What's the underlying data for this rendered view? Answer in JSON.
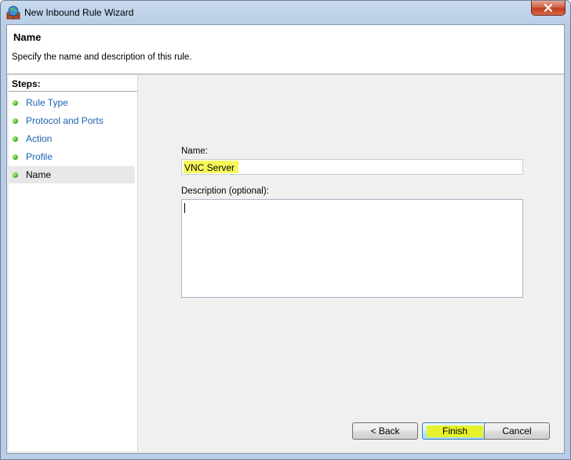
{
  "window": {
    "title": "New Inbound Rule Wizard"
  },
  "header": {
    "title": "Name",
    "description": "Specify the name and description of this rule."
  },
  "steps": {
    "title": "Steps:",
    "items": [
      {
        "label": "Rule Type"
      },
      {
        "label": "Protocol and Ports"
      },
      {
        "label": "Action"
      },
      {
        "label": "Profile"
      },
      {
        "label": "Name"
      }
    ]
  },
  "form": {
    "name_label": "Name:",
    "name_value": "VNC Server",
    "description_label": "Description (optional):",
    "description_value": ""
  },
  "buttons": {
    "back": "< Back",
    "finish": "Finish",
    "cancel": "Cancel"
  },
  "colors": {
    "link": "#1a63b0",
    "highlight": "#f7f95a",
    "step_dot": "#4fb82a"
  }
}
